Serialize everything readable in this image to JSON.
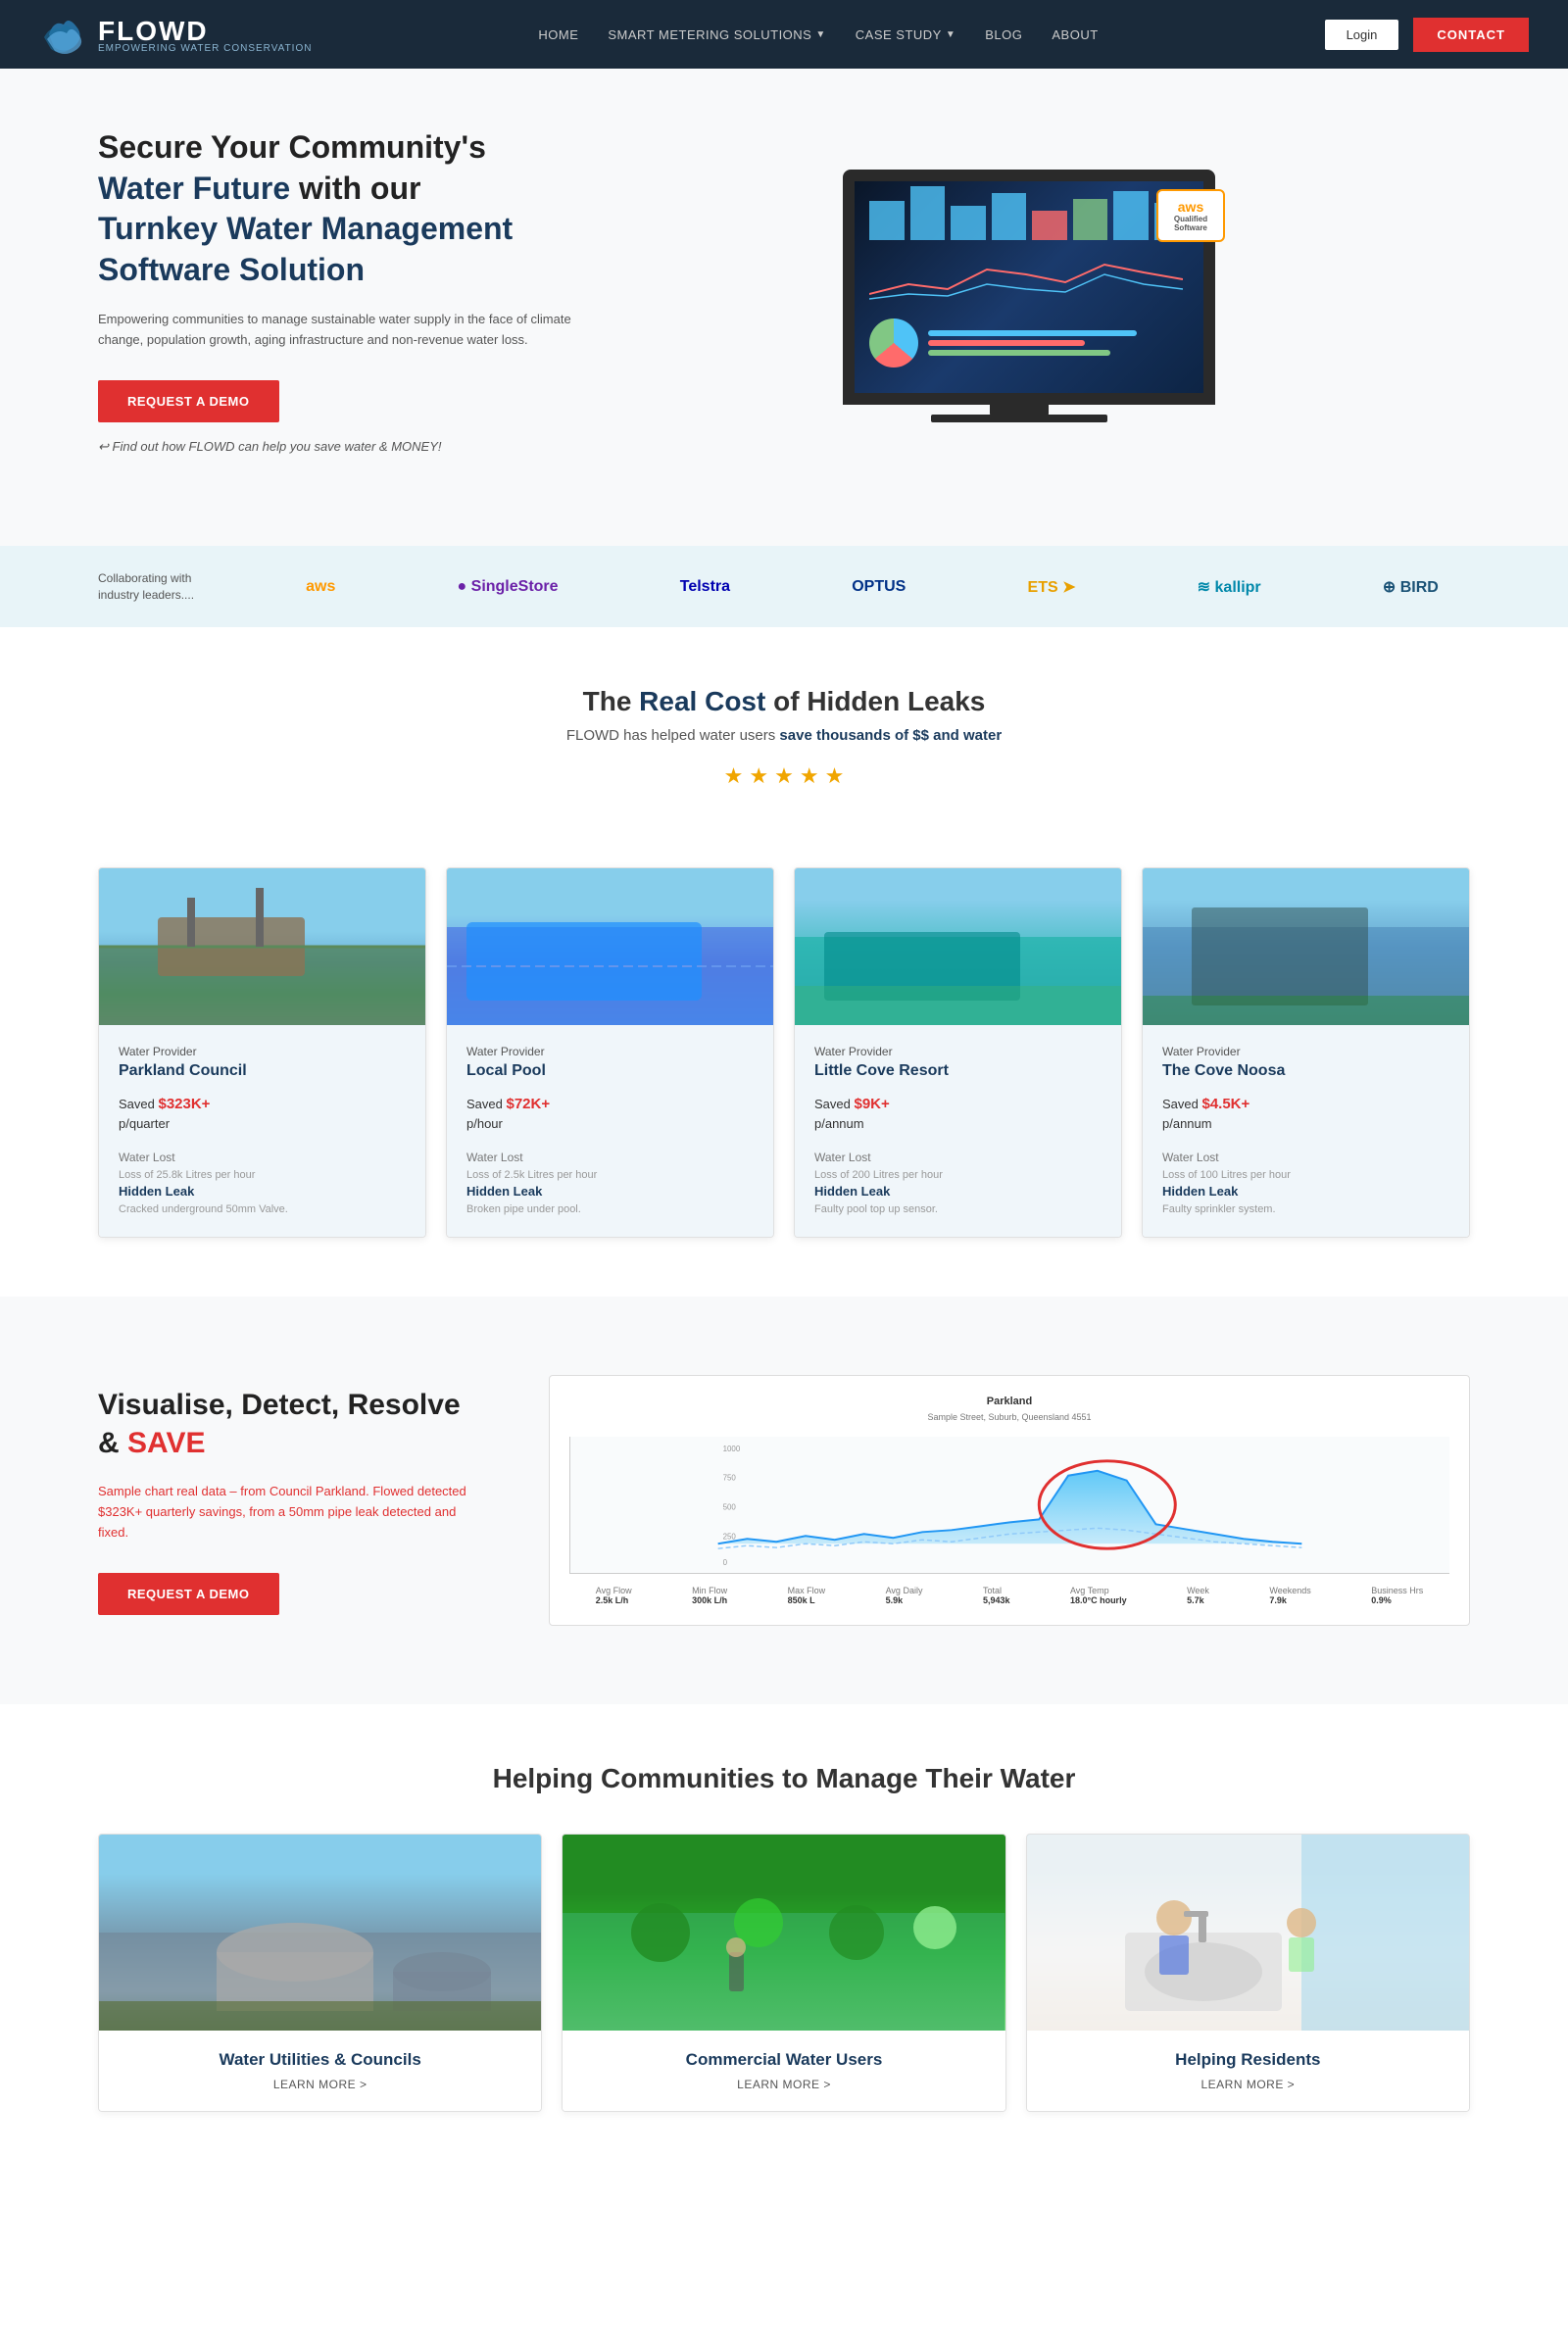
{
  "navbar": {
    "logo_text": "FLOWD",
    "logo_sub": "EMPOWERING WATER CONSERVATION",
    "links": [
      {
        "label": "HOME",
        "has_dropdown": false
      },
      {
        "label": "SMART METERING SOLUTIONS",
        "has_dropdown": true
      },
      {
        "label": "CASE STUDY",
        "has_dropdown": true
      },
      {
        "label": "BLOG",
        "has_dropdown": false
      },
      {
        "label": "ABOUT",
        "has_dropdown": false
      }
    ],
    "login_label": "Login",
    "contact_label": "CONTACT"
  },
  "hero": {
    "headline_1": "Secure Your Community's",
    "headline_2": "Water Future",
    "headline_3": "with our",
    "headline_4": "Turnkey Water Management",
    "headline_5": "Software Solution",
    "description": "Empowering communities to manage sustainable water supply in the face of climate change, population growth, aging infrastructure and non-revenue water loss.",
    "cta_label": "REQUEST A DEMO",
    "note": "Find out how FLOWD can help you save water & MONEY!",
    "aws_line1": "aws",
    "aws_line2": "Qualified",
    "aws_line3": "Software"
  },
  "partners": {
    "label": "Collaborating with industry leaders....",
    "logos": [
      {
        "name": "aws",
        "text": "aws"
      },
      {
        "name": "singlestore",
        "text": "●SingleStore"
      },
      {
        "name": "telstra",
        "text": "Telstra"
      },
      {
        "name": "optus",
        "text": "OPTUS"
      },
      {
        "name": "ets",
        "text": "ETS➤"
      },
      {
        "name": "kallipr",
        "text": "≋ kallipr"
      },
      {
        "name": "bird",
        "text": "⊕ BIRD"
      }
    ]
  },
  "cost_section": {
    "headline_pre": "The ",
    "headline_bold": "Real Cost",
    "headline_post": " of Hidden Leaks",
    "subtitle_pre": "FLOWD has helped water users ",
    "subtitle_bold": "save thousands of $$ and water",
    "stars": [
      "★",
      "★",
      "★",
      "★",
      "★"
    ]
  },
  "cards": [
    {
      "provider": "Water Provider",
      "title": "Parkland Council",
      "saved_label": "Saved ",
      "amount": "$323K+",
      "period": "p/quarter",
      "water_lost_label": "Water Lost",
      "water_lost_detail": "Loss of 25.8k Litres per hour",
      "leak_label": "Hidden Leak",
      "leak_detail": "Cracked underground 50mm Valve."
    },
    {
      "provider": "Water Provider",
      "title": "Local Pool",
      "saved_label": "Saved ",
      "amount": "$72K+",
      "period": "p/hour",
      "water_lost_label": "Water Lost",
      "water_lost_detail": "Loss of 2.5k Litres per hour",
      "leak_label": "Hidden Leak",
      "leak_detail": "Broken pipe under pool."
    },
    {
      "provider": "Water Provider",
      "title": "Little Cove Resort",
      "saved_label": "Saved ",
      "amount": "$9K+",
      "period": "p/annum",
      "water_lost_label": "Water Lost",
      "water_lost_detail": "Loss of 200 Litres per hour",
      "leak_label": "Hidden Leak",
      "leak_detail": "Faulty pool top up sensor."
    },
    {
      "provider": "Water Provider",
      "title": "The Cove Noosa",
      "saved_label": "Saved ",
      "amount": "$4.5K+",
      "period": "p/annum",
      "water_lost_label": "Water Lost",
      "water_lost_detail": "Loss of 100 Litres per hour",
      "leak_label": "Hidden Leak",
      "leak_detail": "Faulty sprinkler system."
    }
  ],
  "visualise": {
    "headline": "Visualise, Detect, Resolve &",
    "save_word": "SAVE",
    "description_pre": "Sample chart ",
    "description_red": "real data",
    "description_post": " – from Council Parkland. Flowed detected ",
    "description_red2": "$323K+",
    "description_post2": " quarterly savings, from a 50mm pipe leak detected and fixed.",
    "cta_label": "REQUEST A DEMO",
    "chart_title": "Parkland",
    "chart_subtitle": "Sample Street, Suburb, Queensland 4551"
  },
  "communities": {
    "headline": "Helping Communities to Manage Their Water",
    "cards": [
      {
        "title": "Water Utilities & Councils",
        "link": "LEARN MORE >"
      },
      {
        "title": "Commercial Water Users",
        "link": "LEARN MORE >"
      },
      {
        "title": "Helping Residents",
        "link": "LEARN MORE >"
      }
    ]
  }
}
